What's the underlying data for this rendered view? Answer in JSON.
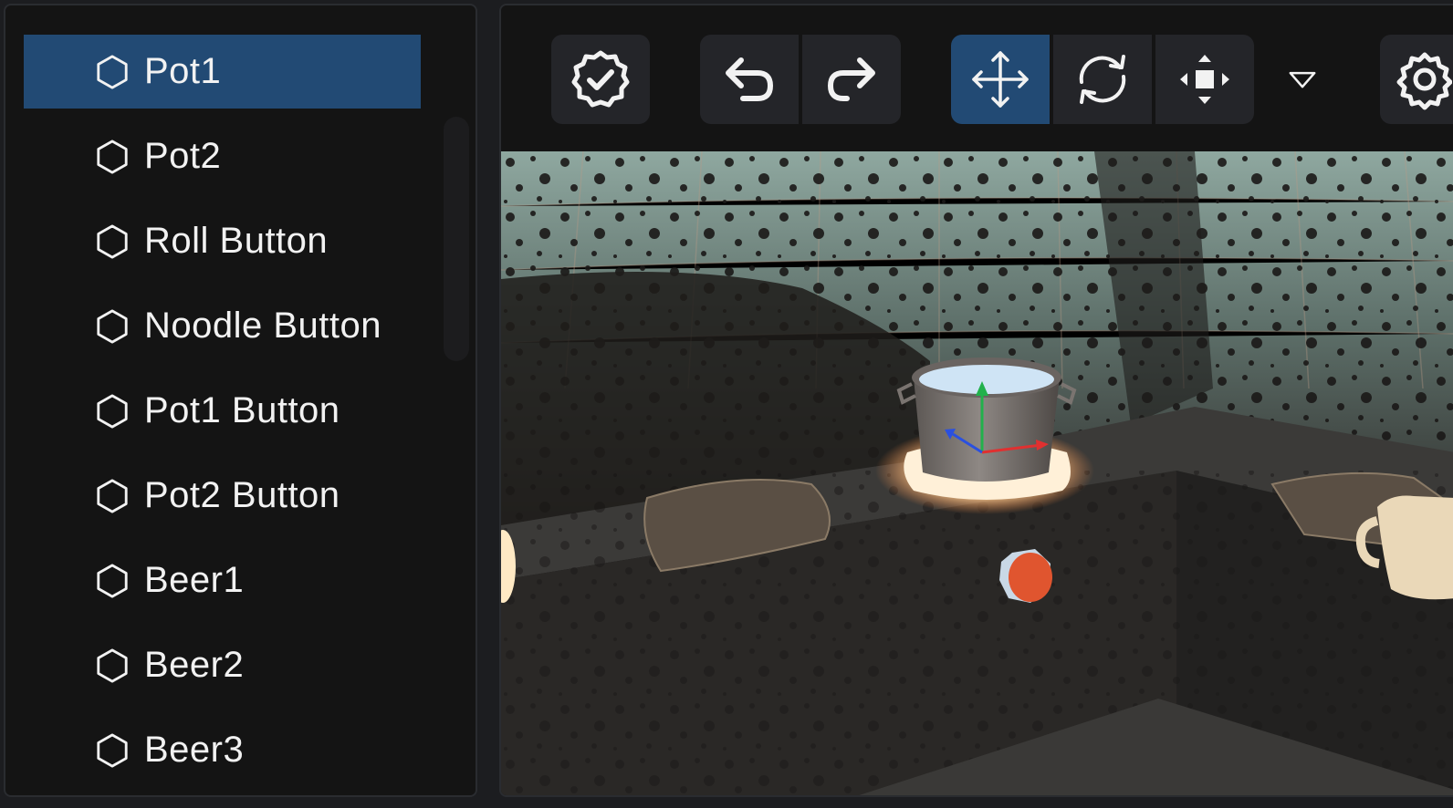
{
  "hierarchy": {
    "items": [
      {
        "label": "Pot1",
        "selected": true
      },
      {
        "label": "Pot2",
        "selected": false
      },
      {
        "label": "Roll Button",
        "selected": false
      },
      {
        "label": "Noodle Button",
        "selected": false
      },
      {
        "label": "Pot1 Button",
        "selected": false
      },
      {
        "label": "Pot2 Button",
        "selected": false
      },
      {
        "label": "Beer1",
        "selected": false
      },
      {
        "label": "Beer2",
        "selected": false
      },
      {
        "label": "Beer3",
        "selected": false
      }
    ],
    "item_icon": "hexagon-icon"
  },
  "toolbar": {
    "buttons": [
      {
        "icon": "verified-badge-icon"
      },
      {
        "icon": "undo-icon"
      },
      {
        "icon": "redo-icon"
      },
      {
        "icon": "move-icon",
        "active": true
      },
      {
        "icon": "rotate-icon"
      },
      {
        "icon": "scale-icon"
      },
      {
        "icon": "chevron-down-icon"
      },
      {
        "icon": "gear-icon"
      }
    ]
  },
  "colors": {
    "selection": "#224a74",
    "panel_bg": "#141414",
    "button_bg": "#242529",
    "text": "#f2f2f2"
  }
}
